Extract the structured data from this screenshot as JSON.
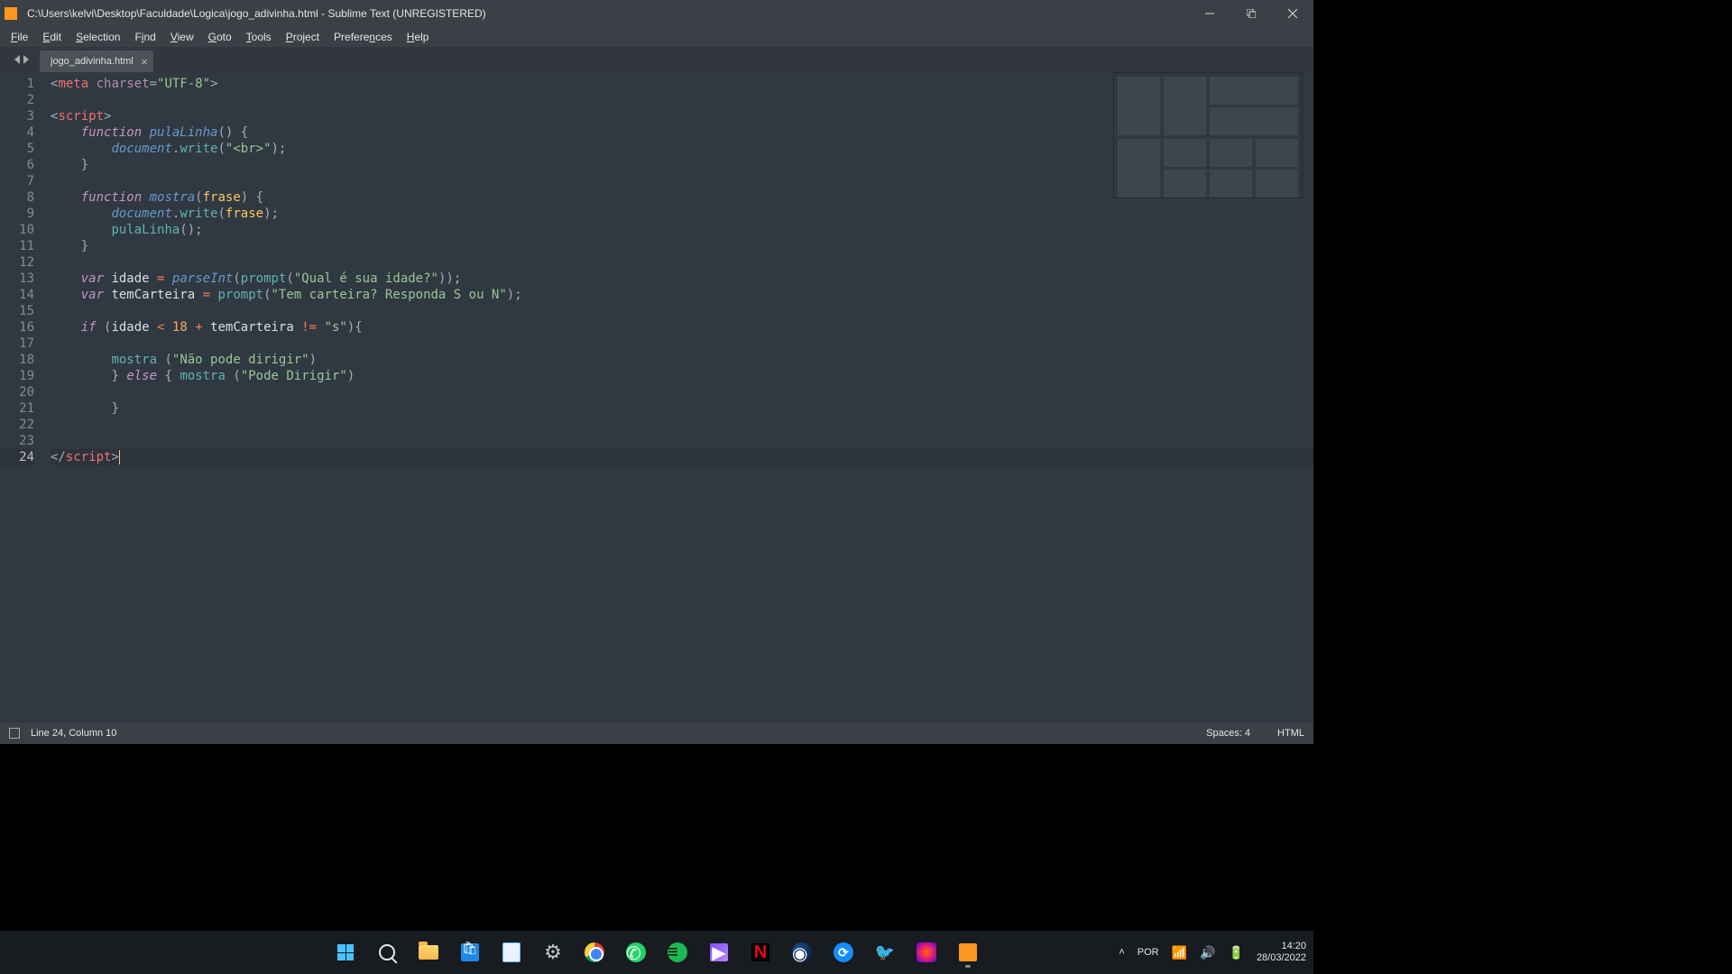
{
  "window": {
    "title": "C:\\Users\\kelvi\\Desktop\\Faculdade\\Logica\\jogo_adivinha.html - Sublime Text (UNREGISTERED)"
  },
  "menu": [
    "File",
    "Edit",
    "Selection",
    "Find",
    "View",
    "Goto",
    "Tools",
    "Project",
    "Preferences",
    "Help"
  ],
  "tab": {
    "name": "jogo_adivinha.html"
  },
  "code_lines": 24,
  "active_line": 24,
  "status": {
    "left": "Line 24, Column 10",
    "spaces": "Spaces: 4",
    "lang": "HTML"
  },
  "systray": {
    "lang": "POR",
    "time": "14:20",
    "date": "28/03/2022"
  },
  "code_tokens": {
    "l1": [
      "<",
      "meta",
      " ",
      "charset",
      "=",
      "\"UTF-8\"",
      ">"
    ],
    "l3": [
      "<",
      "script",
      ">"
    ],
    "l4_kw": "function",
    "l4_name": "pulaLinha",
    "l5_obj": "document",
    "l5_meth": "write",
    "l5_str": "\"<br>\"",
    "l8_kw": "function",
    "l8_name": "mostra",
    "l8_arg": "frase",
    "l9_obj": "document",
    "l9_meth": "write",
    "l9_arg": "frase",
    "l10_call": "pulaLinha",
    "l13_var": "var",
    "l13_id": "idade",
    "l13_fn": "parseInt",
    "l13_pr": "prompt",
    "l13_str": "\"Qual é sua idade?\"",
    "l14_var": "var",
    "l14_id": "temCarteira",
    "l14_pr": "prompt",
    "l14_str": "\"Tem carteira? Responda S ou N\"",
    "l16_if": "if",
    "l16_id1": "idade",
    "l16_num": "18",
    "l16_id2": "temCarteira",
    "l16_str": "\"s\"",
    "l18_call": "mostra",
    "l18_str": "\"Não pode dirigir\"",
    "l19_else": "else",
    "l19_call": "mostra",
    "l19_str": "\"Pode Dirigir\"",
    "l24": [
      "</",
      "script",
      ">"
    ]
  }
}
